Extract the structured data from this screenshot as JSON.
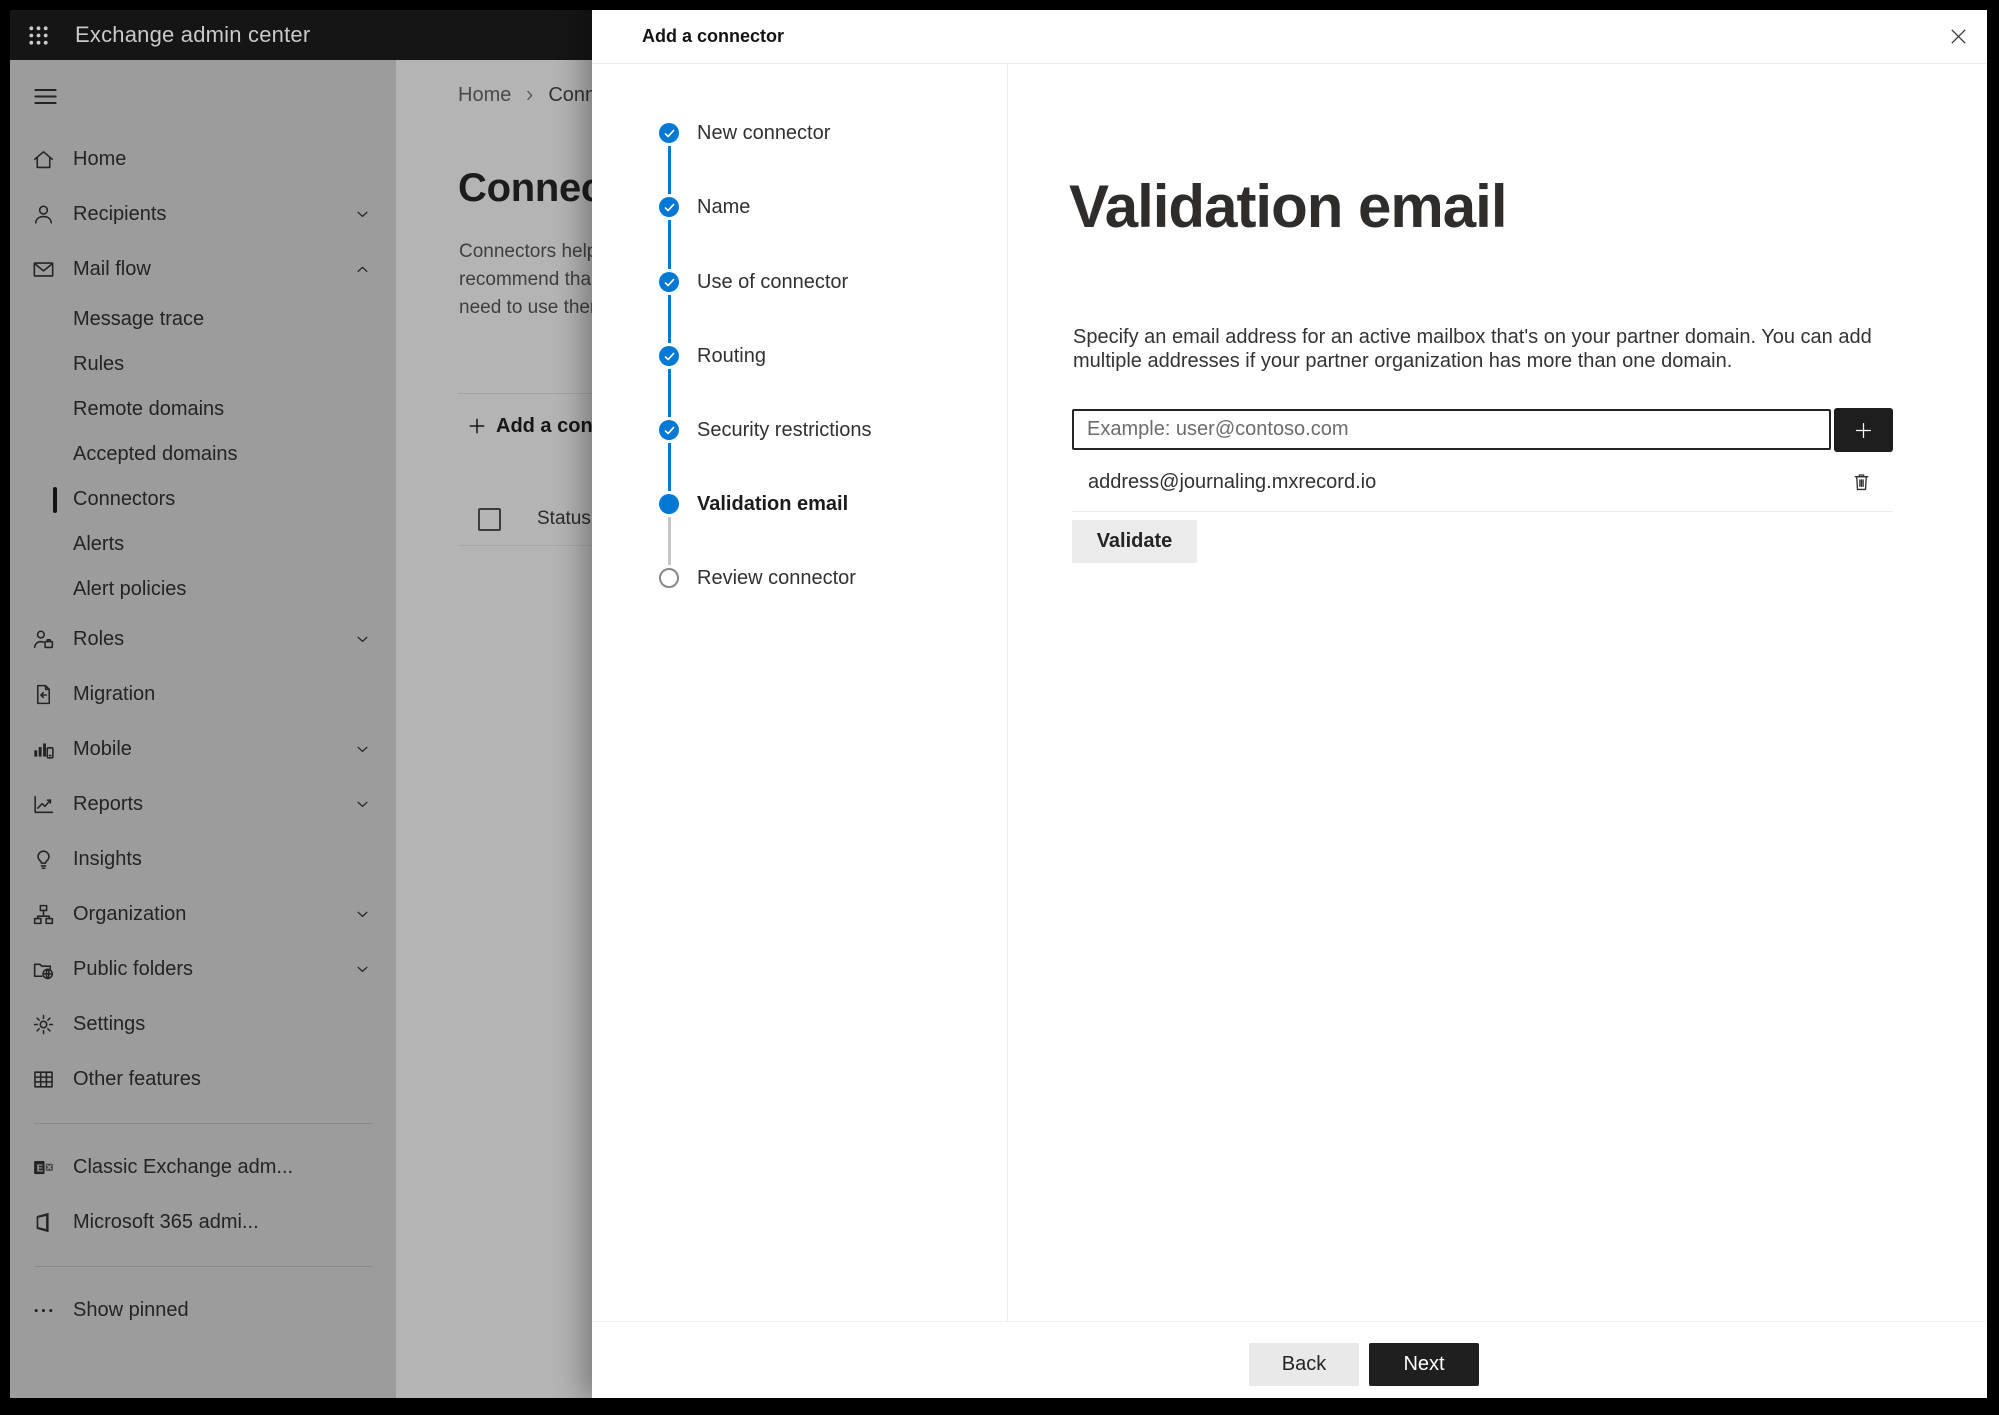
{
  "colors": {
    "accent_blue": "#0078d4",
    "topbar_bg": "#151515",
    "sidebar_bg": "#9c9c9c",
    "page_bg": "#b4b4b4",
    "panel_bg": "#ffffff",
    "dark_button": "#1f1f1f",
    "step_pending_ring": "#8a8886"
  },
  "topbar": {
    "waffle_icon": "app-launcher",
    "app_title": "Exchange admin center"
  },
  "sidebar": {
    "menu_icon": "hamburger",
    "items": [
      {
        "label": "Home",
        "icon": "home-icon"
      },
      {
        "label": "Recipients",
        "icon": "person-icon",
        "chevron": "down"
      },
      {
        "label": "Mail flow",
        "icon": "envelope-icon",
        "chevron": "up",
        "expanded": true
      },
      {
        "label": "Message trace",
        "sub": true
      },
      {
        "label": "Rules",
        "sub": true
      },
      {
        "label": "Remote domains",
        "sub": true
      },
      {
        "label": "Accepted domains",
        "sub": true
      },
      {
        "label": "Connectors",
        "sub": true,
        "selected": true
      },
      {
        "label": "Alerts",
        "sub": true
      },
      {
        "label": "Alert policies",
        "sub": true
      },
      {
        "label": "Roles",
        "icon": "person-briefcase-icon",
        "chevron": "down"
      },
      {
        "label": "Migration",
        "icon": "document-arrow-icon"
      },
      {
        "label": "Mobile",
        "icon": "chart-phone-icon",
        "chevron": "down"
      },
      {
        "label": "Reports",
        "icon": "line-chart-icon",
        "chevron": "down"
      },
      {
        "label": "Insights",
        "icon": "lightbulb-icon"
      },
      {
        "label": "Organization",
        "icon": "org-chart-icon",
        "chevron": "down"
      },
      {
        "label": "Public folders",
        "icon": "folder-globe-icon",
        "chevron": "down"
      },
      {
        "label": "Settings",
        "icon": "gear-icon"
      },
      {
        "label": "Other features",
        "icon": "grid-icon"
      },
      {
        "label": "Classic Exchange adm...",
        "icon": "exchange-logo-icon"
      },
      {
        "label": "Microsoft 365 admi...",
        "icon": "office-logo-icon"
      },
      {
        "label": "Show pinned",
        "icon": "ellipsis-icon"
      }
    ]
  },
  "page": {
    "breadcrumb": {
      "home": "Home",
      "current": "Conne"
    },
    "title": "Connect",
    "intro_lines": [
      "Connectors help",
      "recommend tha",
      "need to use ther"
    ],
    "add_button": "Add a conn",
    "table": {
      "status_header": "Status"
    }
  },
  "panel": {
    "title": "Add a connector",
    "close_icon": "close",
    "steps": [
      {
        "label": "New connector",
        "state": "complete"
      },
      {
        "label": "Name",
        "state": "complete"
      },
      {
        "label": "Use of connector",
        "state": "complete"
      },
      {
        "label": "Routing",
        "state": "complete"
      },
      {
        "label": "Security restrictions",
        "state": "complete"
      },
      {
        "label": "Validation email",
        "state": "current"
      },
      {
        "label": "Review connector",
        "state": "upcoming"
      }
    ],
    "main": {
      "heading": "Validation email",
      "description_line1": "Specify an email address for an active mailbox that's on your partner domain. You can add",
      "description_line2": "multiple addresses if your partner organization has more than one domain.",
      "email_input_placeholder": "Example: user@contoso.com",
      "email_input_value": "",
      "plus_icon": "add",
      "addresses": [
        "address@journaling.mxrecord.io"
      ],
      "trash_icon": "delete",
      "validate_button": "Validate"
    },
    "footer": {
      "back_button": "Back",
      "next_button": "Next"
    }
  }
}
